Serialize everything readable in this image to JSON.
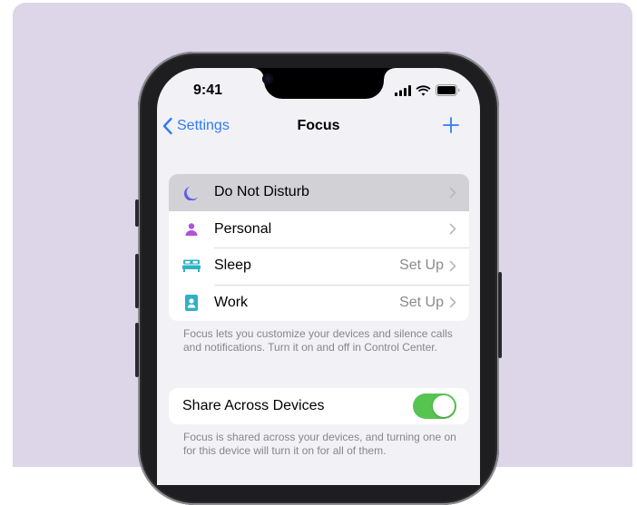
{
  "status_bar": {
    "time": "9:41"
  },
  "nav": {
    "back_label": "Settings",
    "title": "Focus"
  },
  "focus_modes": [
    {
      "label": "Do Not Disturb",
      "value": "",
      "icon": "moon-icon",
      "color": "#5e5ce6"
    },
    {
      "label": "Personal",
      "value": "",
      "icon": "person-icon",
      "color": "#af52de"
    },
    {
      "label": "Sleep",
      "value": "Set Up",
      "icon": "bed-icon",
      "color": "#30b0c7"
    },
    {
      "label": "Work",
      "value": "Set Up",
      "icon": "work-badge-icon",
      "color": "#30b0c7"
    }
  ],
  "focus_footnote": "Focus lets you customize your devices and silence calls and notifications. Turn it on and off in Control Center.",
  "share": {
    "label": "Share Across Devices",
    "enabled": true,
    "footnote": "Focus is shared across your devices, and turning one on for this device will turn it on for all of them."
  },
  "colors": {
    "accent": "#2f7cf6",
    "toggle_on": "#57c452",
    "backdrop": "#dcd6e8"
  }
}
